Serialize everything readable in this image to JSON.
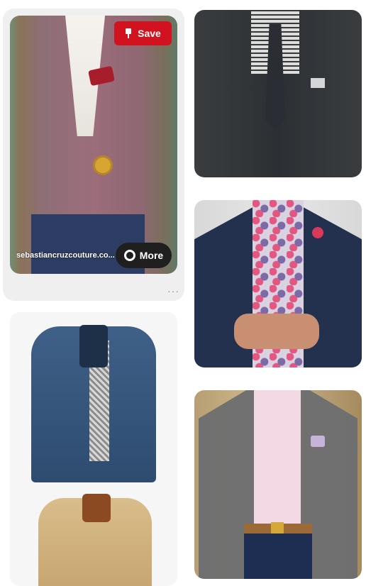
{
  "pins": [
    {
      "id": "pin-maroon",
      "image_alt": "Man in maroon tweed blazer with red pocket square",
      "save_label": "Save",
      "source_domain": "sebastiancruzcouture.co...",
      "more_label": "More",
      "options_label": "···"
    },
    {
      "id": "pin-navy-jacket",
      "image_alt": "Navy blue jacket and tan jacket"
    },
    {
      "id": "pin-charcoal",
      "image_alt": "Charcoal suit with checked shirt and tie"
    },
    {
      "id": "pin-floral",
      "image_alt": "Navy blazer with floral shirt"
    },
    {
      "id": "pin-grey",
      "image_alt": "Grey tweed blazer with pink shirt"
    }
  ],
  "colors": {
    "save_button": "#d1131f",
    "more_button": "#1f1f1f",
    "hover_background": "#efefef"
  },
  "icons": {
    "save": "pin-icon",
    "more": "circle-icon",
    "options": "more-dots-icon"
  }
}
